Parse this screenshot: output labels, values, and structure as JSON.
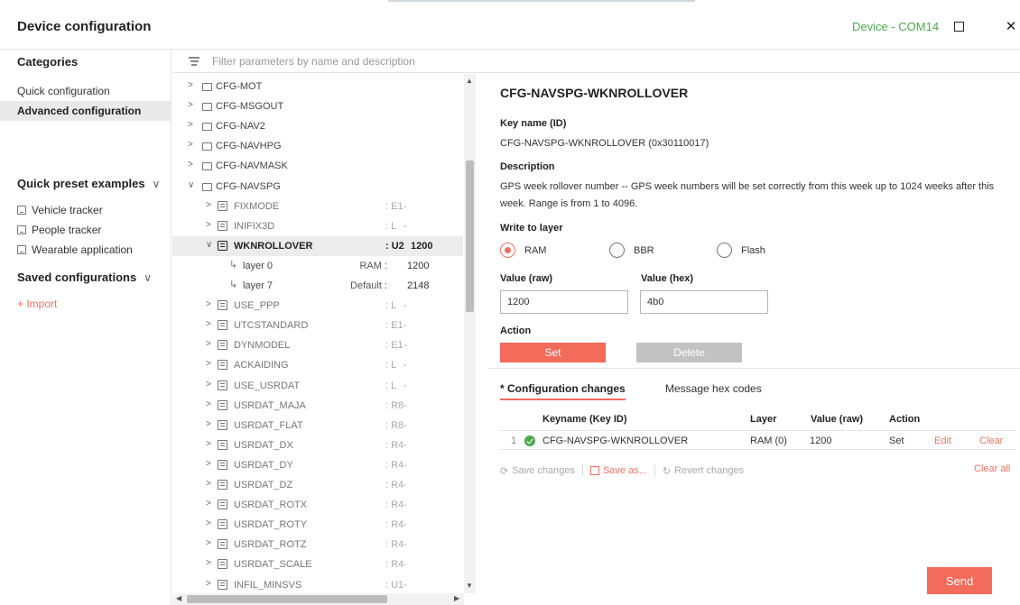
{
  "window": {
    "title": "Device configuration",
    "device": "Device - COM14",
    "maximize_icon": "maximize-icon",
    "close_glyph": "✕"
  },
  "sidebar": {
    "categories_title": "Categories",
    "items": [
      {
        "label": "Quick configuration",
        "active": false
      },
      {
        "label": "Advanced configuration",
        "active": true
      }
    ],
    "presets_title": "Quick preset examples",
    "presets": [
      "Vehicle tracker",
      "People tracker",
      "Wearable application"
    ],
    "saved_title": "Saved configurations",
    "import_label": "+ Import",
    "chevron": "∨"
  },
  "filter": {
    "placeholder": "Filter parameters by name and description",
    "value": ""
  },
  "tree": {
    "groups_top": [
      "CFG-MOT",
      "CFG-MSGOUT",
      "CFG-NAV2",
      "CFG-NAVHPG",
      "CFG-NAVMASK"
    ],
    "open_group": "CFG-NAVSPG",
    "params_before": [
      {
        "name": "FIXMODE",
        "type": ": E1",
        "value": "-"
      },
      {
        "name": "INIFIX3D",
        "type": ": L",
        "value": "-"
      }
    ],
    "selected": {
      "name": "WKNROLLOVER",
      "type": ": U2",
      "value": "1200"
    },
    "layers": [
      {
        "name": "layer 0",
        "source": "RAM :",
        "value": "1200"
      },
      {
        "name": "layer 7",
        "source": "Default :",
        "value": "2148"
      }
    ],
    "params_after": [
      {
        "name": "USE_PPP",
        "type": ": L",
        "value": "-"
      },
      {
        "name": "UTCSTANDARD",
        "type": ": E1",
        "value": "-"
      },
      {
        "name": "DYNMODEL",
        "type": ": E1",
        "value": "-"
      },
      {
        "name": "ACKAIDING",
        "type": ": L",
        "value": "-"
      },
      {
        "name": "USE_USRDAT",
        "type": ": L",
        "value": "-"
      },
      {
        "name": "USRDAT_MAJA",
        "type": ": R8",
        "value": "-"
      },
      {
        "name": "USRDAT_FLAT",
        "type": ": R8",
        "value": "-"
      },
      {
        "name": "USRDAT_DX",
        "type": ": R4",
        "value": "-"
      },
      {
        "name": "USRDAT_DY",
        "type": ": R4",
        "value": "-"
      },
      {
        "name": "USRDAT_DZ",
        "type": ": R4",
        "value": "-"
      },
      {
        "name": "USRDAT_ROTX",
        "type": ": R4",
        "value": "-"
      },
      {
        "name": "USRDAT_ROTY",
        "type": ": R4",
        "value": "-"
      },
      {
        "name": "USRDAT_ROTZ",
        "type": ": R4",
        "value": "-"
      },
      {
        "name": "USRDAT_SCALE",
        "type": ": R4",
        "value": "-"
      },
      {
        "name": "INFIL_MINSVS",
        "type": ": U1",
        "value": "-"
      }
    ]
  },
  "detail": {
    "title": "CFG-NAVSPG-WKNROLLOVER",
    "key_label": "Key name (ID)",
    "key_value": "CFG-NAVSPG-WKNROLLOVER (0x30110017)",
    "desc_label": "Description",
    "desc_value": "GPS week rollover number -- GPS week numbers will be set correctly from this week up to 1024 weeks after this week. Range is from 1 to 4096.",
    "layer_label": "Write to layer",
    "layers": [
      {
        "label": "RAM",
        "selected": true
      },
      {
        "label": "BBR",
        "selected": false
      },
      {
        "label": "Flash",
        "selected": false
      }
    ],
    "raw_label": "Value (raw)",
    "raw_value": "1200",
    "hex_label": "Value (hex)",
    "hex_value": "4b0",
    "action_label": "Action",
    "set_label": "Set",
    "delete_label": "Delete"
  },
  "changes": {
    "tab_active": "* Configuration changes",
    "tab_other": "Message hex codes",
    "columns": [
      "Keyname (Key ID)",
      "Layer",
      "Value (raw)",
      "Action"
    ],
    "rows": [
      {
        "index": "1",
        "key": "CFG-NAVSPG-WKNROLLOVER",
        "layer": "RAM (0)",
        "value": "1200",
        "action": "Set",
        "edit": "Edit",
        "clear": "Clear"
      }
    ],
    "save_changes": "Save changes",
    "save_as": "Save as...",
    "revert": "Revert changes",
    "clear_all": "Clear all",
    "send": "Send"
  },
  "colors": {
    "accent": "#f36b5b",
    "device_green": "#4caa4c",
    "disabled": "#c2c2c2"
  }
}
